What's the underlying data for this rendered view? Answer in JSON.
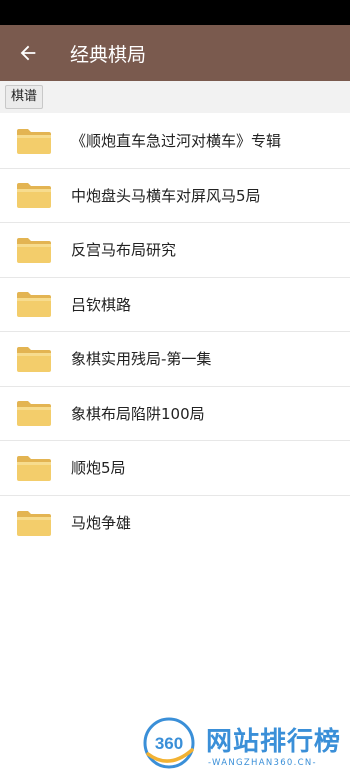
{
  "app_bar": {
    "title": "经典棋局",
    "back_icon": "arrow-left-icon"
  },
  "breadcrumb": {
    "label": "棋谱"
  },
  "folders": [
    {
      "name": "《顺炮直车急过河对横车》专辑",
      "icon": "folder-icon"
    },
    {
      "name": "中炮盘头马横车对屏风马5局",
      "icon": "folder-icon"
    },
    {
      "name": "反宫马布局研究",
      "icon": "folder-icon"
    },
    {
      "name": "吕钦棋路",
      "icon": "folder-icon"
    },
    {
      "name": "象棋实用残局-第一集",
      "icon": "folder-icon"
    },
    {
      "name": "象棋布局陷阱100局",
      "icon": "folder-icon"
    },
    {
      "name": "顺炮5局",
      "icon": "folder-icon"
    },
    {
      "name": "马炮争雄",
      "icon": "folder-icon"
    }
  ],
  "watermark": {
    "logo_text": "360",
    "title": "网站排行榜",
    "subtitle": "-WANGZHAN360.CN-"
  },
  "colors": {
    "app_bar": "#7a5a4e",
    "folder_body": "#f3cd6b",
    "folder_tab": "#e3b452",
    "watermark": "#3a8fd8"
  }
}
